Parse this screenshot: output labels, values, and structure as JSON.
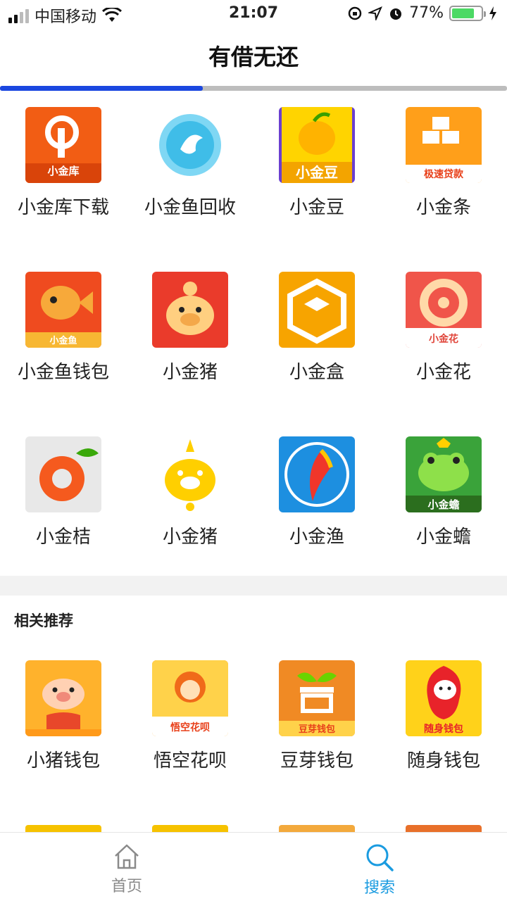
{
  "status_bar": {
    "carrier": "中国移动",
    "time": "21:07",
    "battery": "77%",
    "battery_level": 0.77
  },
  "header": {
    "title": "有借无还"
  },
  "tab_indicator": {
    "progress": 0.4
  },
  "apps": [
    {
      "name": "小金库下载",
      "icon": "xiaojinku-logo",
      "bg": "#f25d14",
      "icon_text": "小金库"
    },
    {
      "name": "小金鱼回收",
      "icon": "fish-logo",
      "bg": "#ffffff",
      "icon_text": ""
    },
    {
      "name": "小金豆",
      "icon": "bean-logo",
      "bg": "#6a3fd0",
      "icon_text": "小金豆"
    },
    {
      "name": "小金条",
      "icon": "gold-bar-logo",
      "bg": "#ff9f1a",
      "icon_text": "极速贷款"
    },
    {
      "name": "小金鱼钱包",
      "icon": "goldfish-logo",
      "bg": "#ef4b1f",
      "icon_text": "小金鱼"
    },
    {
      "name": "小金猪",
      "icon": "piggy-logo",
      "bg": "#ea3b2b",
      "icon_text": ""
    },
    {
      "name": "小金盒",
      "icon": "box-logo",
      "bg": "#f7a400",
      "icon_text": ""
    },
    {
      "name": "小金花",
      "icon": "flower-logo",
      "bg": "#f0554a",
      "icon_text": "小金花"
    },
    {
      "name": "小金桔",
      "icon": "orange-logo",
      "bg": "#e8e8e8",
      "icon_text": ""
    },
    {
      "name": "小金猪",
      "icon": "golden-pig-logo",
      "bg": "#ffffff",
      "icon_text": ""
    },
    {
      "name": "小金渔",
      "icon": "goldfish-blue-logo",
      "bg": "#1d8fe0",
      "icon_text": ""
    },
    {
      "name": "小金蟾",
      "icon": "frog-logo",
      "bg": "#3aa33a",
      "icon_text": "小金蟾"
    }
  ],
  "section": {
    "title": "相关推荐"
  },
  "recommended": [
    {
      "name": "小猪钱包",
      "icon": "pig-wallet-logo",
      "bg": "#ffb22c",
      "icon_text": ""
    },
    {
      "name": "悟空花呗",
      "icon": "wukong-logo",
      "bg": "#ff7a2a",
      "icon_text": "悟空花呗"
    },
    {
      "name": "豆芽钱包",
      "icon": "sprout-logo",
      "bg": "#f08a24",
      "icon_text": "豆芽钱包"
    },
    {
      "name": "随身钱包",
      "icon": "mascot-logo",
      "bg": "#ffd21a",
      "icon_text": "随身钱包"
    }
  ],
  "peek_colors": [
    "#f6c200",
    "#f6c200",
    "#f3a93c",
    "#e8702a"
  ],
  "nav": {
    "home_label": "首页",
    "search_label": "搜索",
    "active_color": "#1a9be0",
    "inactive_color": "#8a8a8a"
  }
}
